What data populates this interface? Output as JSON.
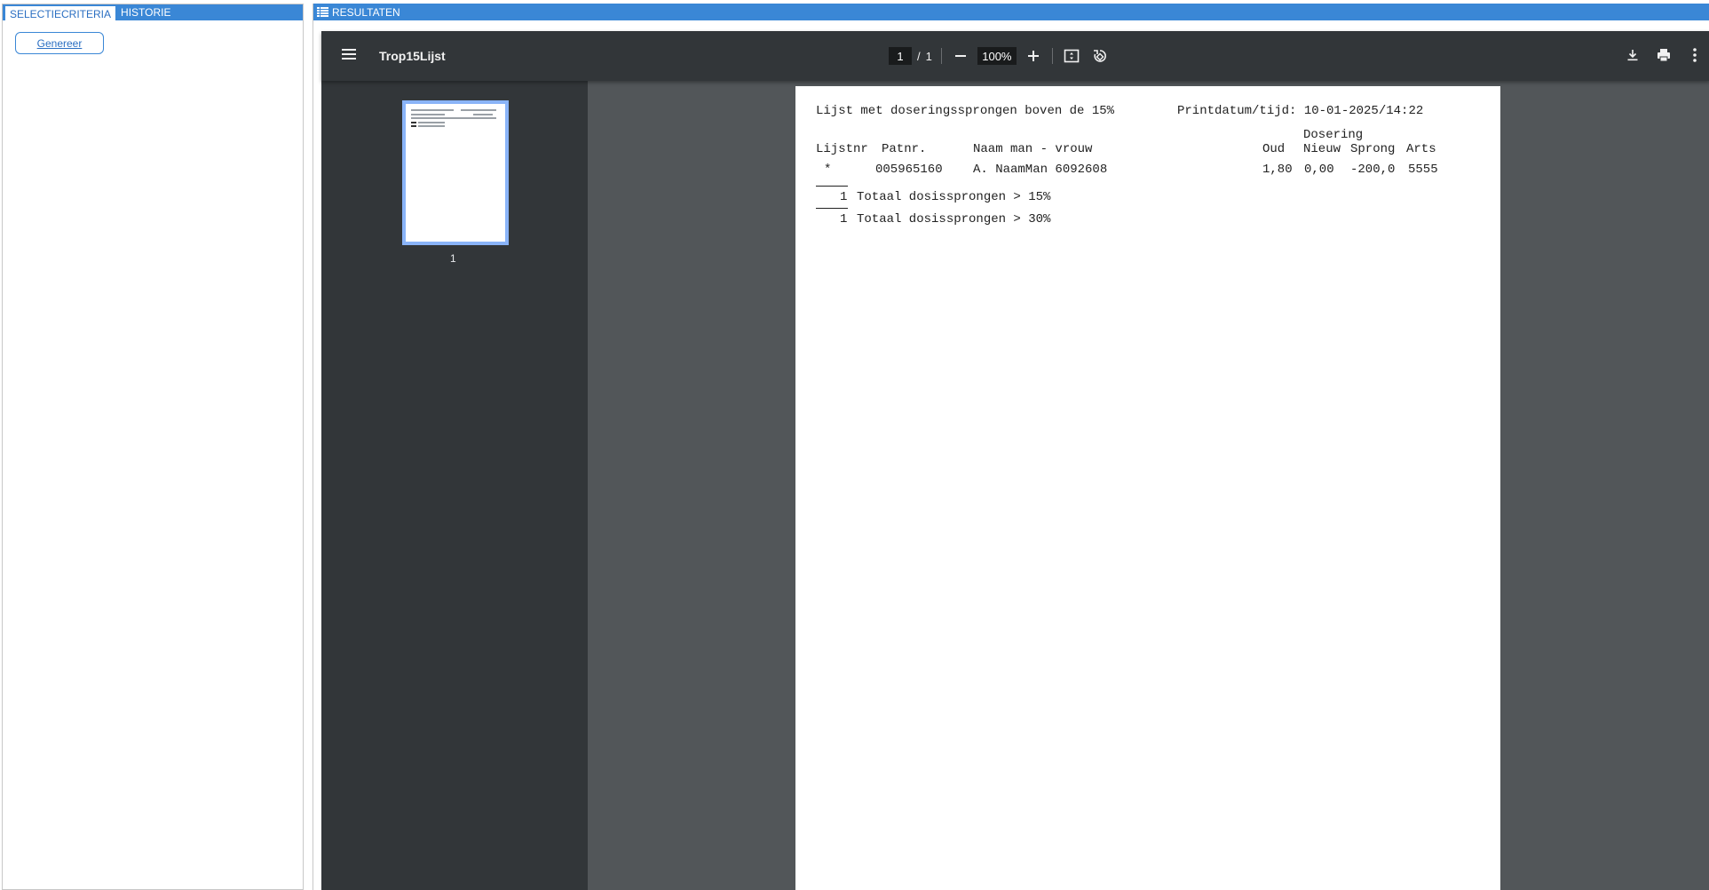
{
  "left_tabs": [
    "SELECTIECRITERIA",
    "HISTORIE"
  ],
  "generate_button": "Genereer",
  "results_header": "RESULTATEN",
  "viewer": {
    "title": "Trop15Lijst",
    "page_current": "1",
    "page_sep": "/",
    "page_total": "1",
    "zoom": "100%",
    "thumbnail_label": "1"
  },
  "doc": {
    "title": "Lijst met doseringssprongen boven de 15%",
    "printdate": "Printdatum/tijd: 10-01-2025/14:22",
    "group_header": "Dosering",
    "columns": {
      "lijstnr": "Lijstnr",
      "patnr": "Patnr.",
      "naam": "Naam man - vrouw",
      "oud": "Oud",
      "nieuw": "Nieuw",
      "sprong": "Sprong",
      "arts": "Arts"
    },
    "rows": [
      {
        "lijstnr": "*",
        "patnr": "005965160",
        "naam": "A. NaamMan 6092608",
        "oud": "1,80",
        "nieuw": "0,00",
        "sprong": "-200,0",
        "arts": "5555"
      }
    ],
    "totals": [
      {
        "count": "1",
        "label": "Totaal dosissprongen > 15%"
      },
      {
        "count": "1",
        "label": "Totaal dosissprongen > 30%"
      }
    ]
  }
}
